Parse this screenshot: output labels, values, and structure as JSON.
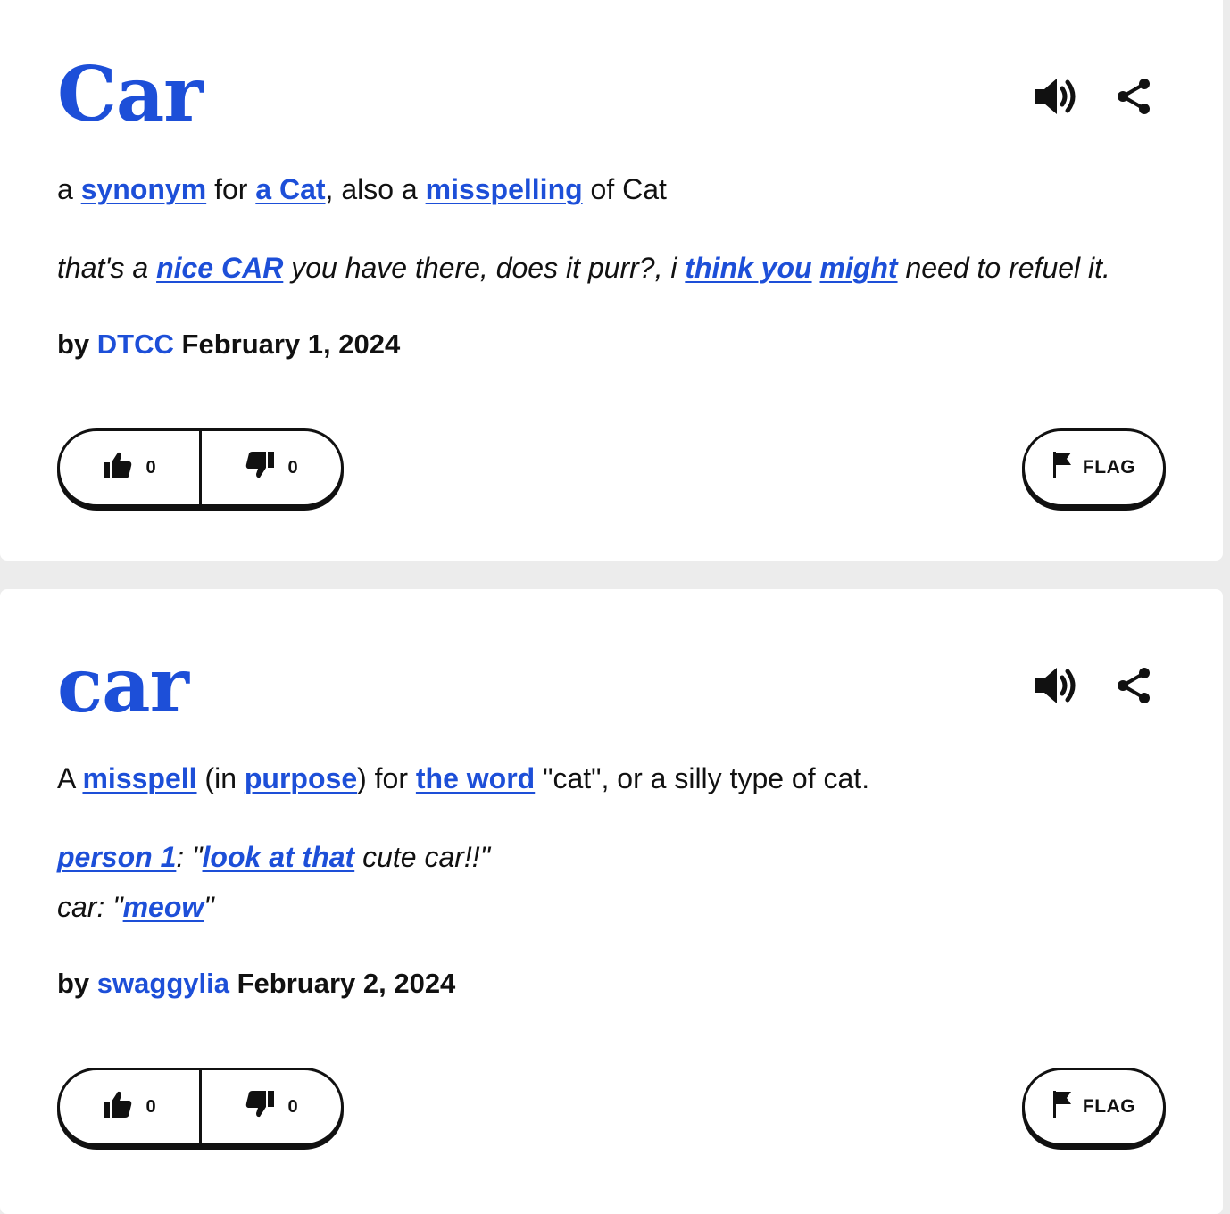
{
  "entries": [
    {
      "word": "Car",
      "meaning": {
        "t1": "a ",
        "l1": "synonym",
        "t2": " for ",
        "l2": "a Cat",
        "t3": ", also a ",
        "l3": "misspelling",
        "t4": " of Cat"
      },
      "example": {
        "t1": "that's a ",
        "l1": "nice CAR",
        "t2": " you have there, does it purr?, i ",
        "l2": "think you",
        "t3": " ",
        "l3": "might",
        "t4": " need to refuel it."
      },
      "contributor": {
        "by": "by ",
        "author": "DTCC",
        "date": " February 1, 2024"
      },
      "upvotes": "0",
      "downvotes": "0",
      "flag_label": "FLAG"
    },
    {
      "word": "car",
      "meaning": {
        "t1": "A ",
        "l1": "misspell",
        "t2": " (in ",
        "l2": "purpose",
        "t3": ") for ",
        "l3": "the word",
        "t4": " \"cat\", or a silly type of cat."
      },
      "example": {
        "line1_l1": "person 1",
        "line1_t1": ": \"",
        "line1_l2": "look at that",
        "line1_t2": " cute car!!\"",
        "line2_t1": "car: \"",
        "line2_l1": "meow",
        "line2_t2": "\""
      },
      "contributor": {
        "by": "by ",
        "author": "swaggylia",
        "date": " February 2, 2024"
      },
      "upvotes": "0",
      "downvotes": "0",
      "flag_label": "FLAG"
    }
  ],
  "icons": {
    "speaker": "speaker-icon",
    "share": "share-icon",
    "thumbs_up": "thumbs-up-icon",
    "thumbs_down": "thumbs-down-icon",
    "flag": "flag-icon"
  },
  "colors": {
    "link": "#1d4fd8",
    "text": "#111111",
    "card": "#ffffff",
    "background": "#ececec"
  }
}
